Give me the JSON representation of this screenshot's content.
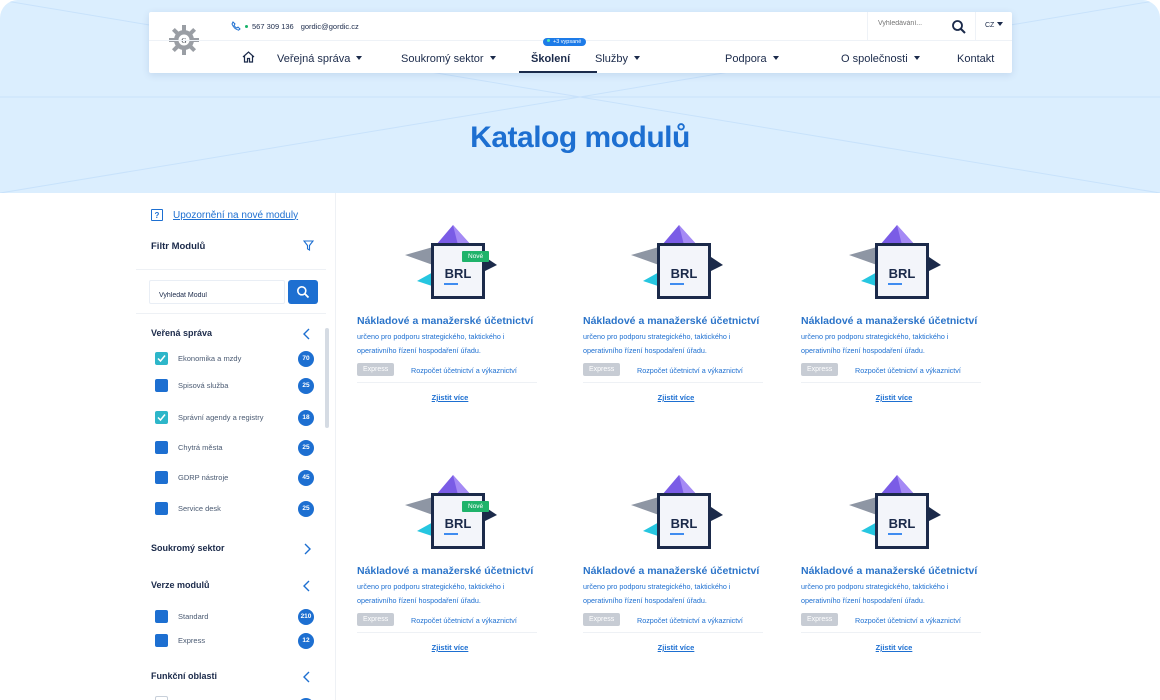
{
  "header": {
    "phone": "567 309 136",
    "email": "gordic@gordic.cz",
    "search_placeholder": "Vyhledávání...",
    "language": "CZ",
    "nav": [
      {
        "label": "Veřejná správa",
        "has_dropdown": true
      },
      {
        "label": "Soukromý sektor",
        "has_dropdown": true
      },
      {
        "label": "Školení",
        "has_dropdown": false,
        "active": true
      },
      {
        "label": "Služby",
        "has_dropdown": true
      },
      {
        "label": "Podpora",
        "has_dropdown": true
      },
      {
        "label": "O společnosti",
        "has_dropdown": true
      },
      {
        "label": "Kontakt",
        "has_dropdown": false
      }
    ],
    "training_badge": "+3 vypsané"
  },
  "hero": {
    "title": "Katalog modulů"
  },
  "sidebar": {
    "notice_link": "Upozornění na nové moduly",
    "filter_title": "Filtr Modulů",
    "search_value": "Vyhledat Modul",
    "groups": [
      {
        "title": "Veřená správa",
        "expanded": true,
        "items": [
          {
            "label": "Ekonomika a mzdy",
            "count": "70",
            "checked": true
          },
          {
            "label": "Spisová služba",
            "count": "25",
            "checked": false
          },
          {
            "label": "Správní agendy a registry",
            "count": "18",
            "checked": true
          },
          {
            "label": "Chytrá města",
            "count": "25",
            "checked": false
          },
          {
            "label": "GDRP nástroje",
            "count": "45",
            "checked": false
          },
          {
            "label": "Service desk",
            "count": "25",
            "checked": false
          }
        ]
      },
      {
        "title": "Soukromý sektor",
        "expanded": false,
        "items": []
      },
      {
        "title": "Verze modulů",
        "expanded": true,
        "items": [
          {
            "label": "Standard",
            "count": "210",
            "checked": false
          },
          {
            "label": "Express",
            "count": "12",
            "checked": false
          }
        ]
      },
      {
        "title": "Funkční oblasti",
        "expanded": true,
        "items": []
      }
    ]
  },
  "cards": [
    {
      "logo_text": "BRL",
      "is_new": true,
      "new_label": "Nové",
      "title": "Nákladové a manažerské účetnictví",
      "description": "určeno pro podporu strategického, taktického i operativního řízení hospodaření úřadu.",
      "tag": "Express",
      "tag_text": "Rozpočet účetnictví a výkaznictví",
      "more": "Zjistit více"
    },
    {
      "logo_text": "BRL",
      "is_new": false,
      "new_label": "",
      "title": "Nákladové a manažerské účetnictví",
      "description": "určeno pro podporu strategického, taktického i operativního řízení hospodaření úřadu.",
      "tag": "Express",
      "tag_text": "Rozpočet účetnictví a výkaznictví",
      "more": "Zjistit více"
    },
    {
      "logo_text": "BRL",
      "is_new": false,
      "new_label": "",
      "title": "Nákladové a manažerské účetnictví",
      "description": "určeno pro podporu strategického, taktického i operativního řízení hospodaření úřadu.",
      "tag": "Express",
      "tag_text": "Rozpočet účetnictví a výkaznictví",
      "more": "Zjistit více"
    },
    {
      "logo_text": "BRL",
      "is_new": true,
      "new_label": "Nové",
      "title": "Nákladové a manažerské účetnictví",
      "description": "určeno pro podporu strategického, taktického i operativního řízení hospodaření úřadu.",
      "tag": "Express",
      "tag_text": "Rozpočet účetnictví a výkaznictví",
      "more": "Zjistit více"
    },
    {
      "logo_text": "BRL",
      "is_new": false,
      "new_label": "",
      "title": "Nákladové a manažerské účetnictví",
      "description": "určeno pro podporu strategického, taktického i operativního řízení hospodaření úřadu.",
      "tag": "Express",
      "tag_text": "Rozpočet účetnictví a výkaznictví",
      "more": "Zjistit více"
    },
    {
      "logo_text": "BRL",
      "is_new": false,
      "new_label": "",
      "title": "Nákladové a manažerské účetnictví",
      "description": "určeno pro podporu strategického, taktického i operativního řízení hospodaření úřadu.",
      "tag": "Express",
      "tag_text": "Rozpočet účetnictví a výkaznictví",
      "more": "Zjistit více"
    }
  ],
  "colors": {
    "primary": "#1d6fd1",
    "hero_bg": "#dbeefe",
    "new_badge": "#1fb36b",
    "check": "#2db6c9",
    "tag_bg": "#c7ccd4"
  },
  "icons": {
    "logo": "gear-logo-icon",
    "phone": "phone-icon",
    "search": "search-icon",
    "home": "home-icon",
    "question": "question-icon",
    "filter": "filter-icon",
    "chevron_left": "chevron-left-icon",
    "chevron_right": "chevron-right-icon",
    "check": "check-icon"
  }
}
